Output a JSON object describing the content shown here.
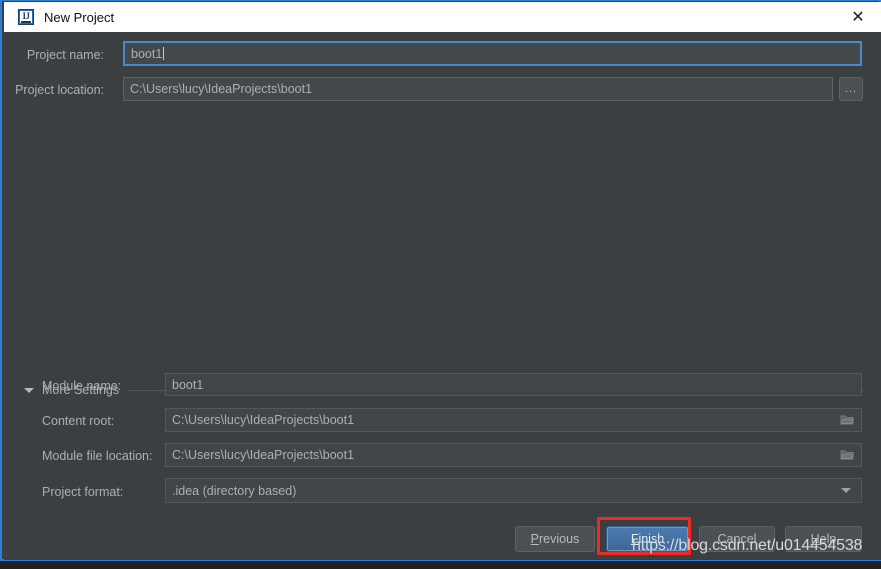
{
  "window": {
    "title": "New Project",
    "app_icon": "intellij-idea-icon",
    "close_icon": "close-icon",
    "border_color": "#2d7fd6",
    "background_color": "#3c3f41"
  },
  "form": {
    "project_name": {
      "label": "Project name:",
      "value": "boot1",
      "focused": true
    },
    "project_location": {
      "label": "Project location:",
      "value": "C:\\Users\\lucy\\IdeaProjects\\boot1",
      "browse_label": "...",
      "browse_icon": "ellipsis-icon"
    }
  },
  "more_settings": {
    "label": "More Settings",
    "expanded": true,
    "toggle_icon": "triangle-down-icon",
    "fields": [
      {
        "name": "module-name",
        "label": "Module name:",
        "value": "boot1",
        "trailing_icon": null
      },
      {
        "name": "content-root",
        "label": "Content root:",
        "value": "C:\\Users\\lucy\\IdeaProjects\\boot1",
        "trailing_icon": "folder-icon"
      },
      {
        "name": "module-file-location",
        "label": "Module file location:",
        "value": "C:\\Users\\lucy\\IdeaProjects\\boot1",
        "trailing_icon": "folder-icon"
      },
      {
        "name": "project-format",
        "label": "Project format:",
        "value": ".idea (directory based)",
        "trailing_icon": "chevron-down-icon"
      }
    ]
  },
  "buttons": {
    "previous": {
      "label": "Previous",
      "mnemonic": "P",
      "primary": false
    },
    "finish": {
      "label": "Finish",
      "mnemonic": "F",
      "primary": true
    },
    "cancel": {
      "label": "Cancel",
      "mnemonic": "",
      "primary": false
    },
    "help": {
      "label": "Help",
      "mnemonic": "H",
      "primary": false
    }
  },
  "annotation": {
    "highlight_color": "#f02a21",
    "target": "finish-button"
  },
  "watermark": {
    "text": "https://blog.csdn.net/u014454538"
  }
}
